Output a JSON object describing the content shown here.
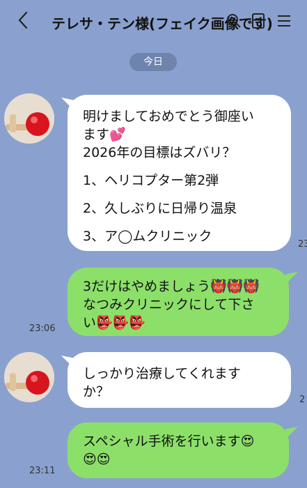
{
  "header": {
    "back_icon": "chevron-left-icon",
    "title": "テレサ・テン様(フェイク画像です)",
    "icons": [
      "search-icon",
      "note-icon",
      "menu-icon"
    ]
  },
  "date_label": "今日",
  "messages": [
    {
      "side": "in",
      "lines": [
        "明けましておめでとう御座い",
        "ます💕",
        "2026年の目標はズバリ？",
        "",
        "1、ヘリコプター第2弾",
        "",
        "2、久しぶりに日帰り温泉",
        "",
        "3、ア◯ムクリニック"
      ],
      "time": "23"
    },
    {
      "side": "out",
      "lines": [
        "3だけはやめましょう👹👹👹",
        "なつみクリニックにして下さ",
        "い👺👺👺"
      ],
      "time": "23:06"
    },
    {
      "side": "in",
      "lines": [
        "しっかり治療してくれます",
        "か？"
      ],
      "time": "2"
    },
    {
      "side": "out",
      "lines": [
        "スペシャル手術を行います😍",
        "😍😍"
      ],
      "time": "23:11"
    }
  ]
}
